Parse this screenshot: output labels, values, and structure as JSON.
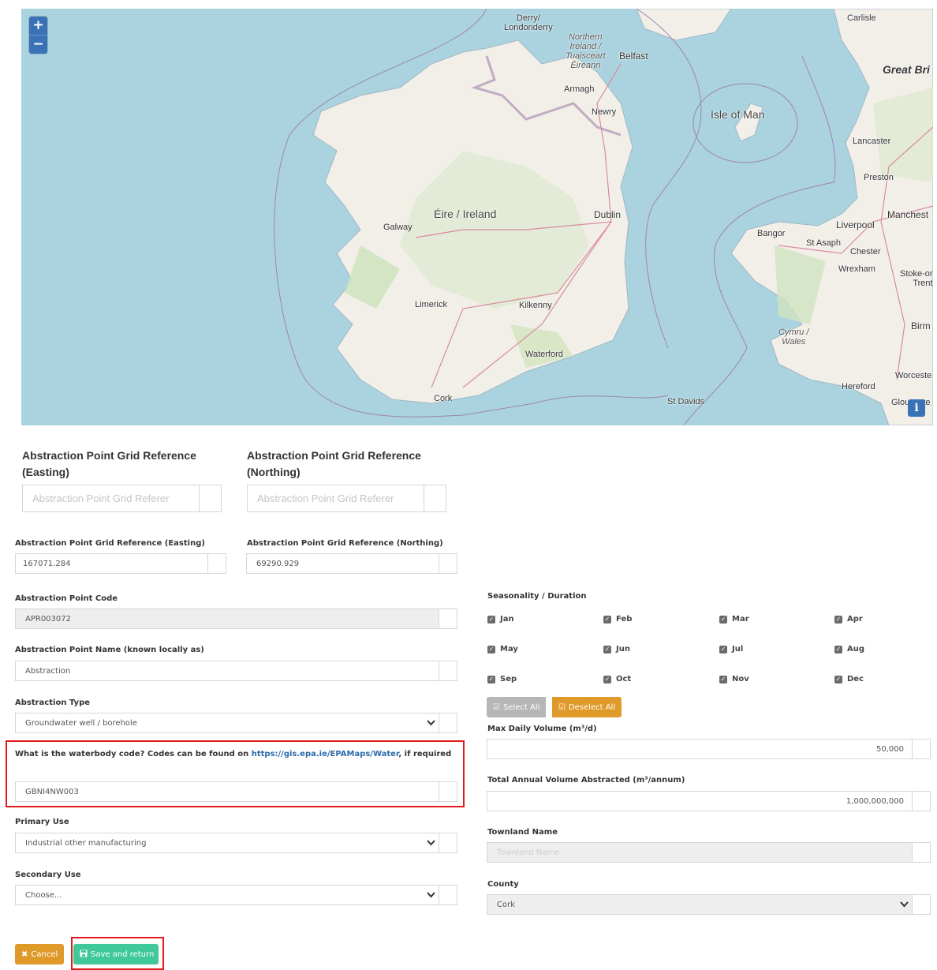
{
  "map": {
    "zoom_in": "+",
    "zoom_out": "−",
    "info": "i",
    "places": [
      {
        "id": "derry",
        "text": "Derry/\nLondonderry",
        "style": "pl",
        "css": "left:612px;top:6px;text-align:center;"
      },
      {
        "id": "ni",
        "text": "Northern\nIreland /\nTuaisceart\nÉireann",
        "style": "pl it",
        "css": "left:690px;top:30px;text-align:center;line-height:12px;"
      },
      {
        "id": "belfast",
        "text": "Belfast",
        "style": "pl",
        "css": "left:758px;top:53px;font-size:12px;"
      },
      {
        "id": "armagh",
        "text": "Armagh",
        "style": "pl",
        "css": "left:688px;top:96px;"
      },
      {
        "id": "newry",
        "text": "Newry",
        "style": "pl",
        "css": "left:723px;top:125px;"
      },
      {
        "id": "carlisle",
        "text": "Carlisle",
        "style": "pl",
        "css": "left:1047px;top:6px;"
      },
      {
        "id": "great",
        "text": "Great Bri",
        "style": "pl big it",
        "css": "left:1092px;top:69px;font-weight:bold;color:#333;"
      },
      {
        "id": "iom",
        "text": "Isle of Man",
        "style": "pl big",
        "css": "left:874px;top:126px;"
      },
      {
        "id": "lancaster",
        "text": "Lancaster",
        "style": "pl",
        "css": "left:1054px;top:162px;"
      },
      {
        "id": "preston",
        "text": "Preston",
        "style": "pl",
        "css": "left:1068px;top:208px;"
      },
      {
        "id": "ireland",
        "text": "Éire / Ireland",
        "style": "pl big",
        "css": "left:523px;top:252px;"
      },
      {
        "id": "dublin",
        "text": "Dublin",
        "style": "pl",
        "css": "left:726px;top:254px;font-size:12px;"
      },
      {
        "id": "galway",
        "text": "Galway",
        "style": "pl",
        "css": "left:459px;top:271px;"
      },
      {
        "id": "manchester",
        "text": "Manchest",
        "style": "pl",
        "css": "left:1098px;top:254px;font-size:12px;"
      },
      {
        "id": "liverpool",
        "text": "Liverpool",
        "style": "pl",
        "css": "left:1033px;top:267px;font-size:12px;"
      },
      {
        "id": "bangor",
        "text": "Bangor",
        "style": "pl",
        "css": "left:933px;top:279px;"
      },
      {
        "id": "stasaph",
        "text": "St Asaph",
        "style": "pl",
        "css": "left:995px;top:291px;"
      },
      {
        "id": "chester",
        "text": "Chester",
        "style": "pl",
        "css": "left:1051px;top:302px;"
      },
      {
        "id": "wrexham",
        "text": "Wrexham",
        "style": "pl",
        "css": "left:1036px;top:324px;"
      },
      {
        "id": "stoke",
        "text": "Stoke-or\nTrent",
        "style": "pl",
        "css": "left:1114px;top:330px;text-align:right;line-height:12px;"
      },
      {
        "id": "limerick",
        "text": "Limerick",
        "style": "pl",
        "css": "left:499px;top:369px;"
      },
      {
        "id": "kilkenny",
        "text": "Kilkenny",
        "style": "pl",
        "css": "left:631px;top:370px;"
      },
      {
        "id": "birm",
        "text": "Birm",
        "style": "pl",
        "css": "left:1128px;top:395px;font-size:12px;"
      },
      {
        "id": "wales",
        "text": "Cymru /\nWales",
        "style": "pl it",
        "css": "left:960px;top:404px;text-align:center;line-height:12px;"
      },
      {
        "id": "waterford",
        "text": "Waterford",
        "style": "pl",
        "css": "left:639px;top:432px;"
      },
      {
        "id": "worcester",
        "text": "Worceste",
        "style": "pl",
        "css": "left:1108px;top:459px;"
      },
      {
        "id": "hereford",
        "text": "Hereford",
        "style": "pl",
        "css": "left:1040px;top:473px;"
      },
      {
        "id": "cork",
        "text": "Cork",
        "style": "pl",
        "css": "left:523px;top:488px;"
      },
      {
        "id": "stdavids",
        "text": "St Davids",
        "style": "pl",
        "css": "left:819px;top:492px;"
      },
      {
        "id": "glouc",
        "text": "Glouceste",
        "style": "pl",
        "css": "left:1103px;top:493px;"
      }
    ]
  },
  "top_grid": {
    "easting_label": "Abstraction Point Grid Reference (Easting)",
    "northing_label": "Abstraction Point Grid Reference (Northing)",
    "easting_placeholder": "Abstraction Point Grid Referer",
    "northing_placeholder": "Abstraction Point Grid Referer"
  },
  "form": {
    "easting_label": "Abstraction Point Grid Reference (Easting)",
    "easting_value": "167071.284",
    "northing_label": "Abstraction Point Grid Reference (Northing)",
    "northing_value": "69290.929",
    "code_label": "Abstraction Point Code",
    "code_value": "APR003072",
    "name_label": "Abstraction Point Name (known locally as)",
    "name_value": "Abstraction",
    "type_label": "Abstraction Type",
    "type_value": "Groundwater well / borehole",
    "waterbody_label_pre": "What is the waterbody code? Codes can be found on ",
    "waterbody_link": "https://gis.epa.ie/EPAMaps/Water",
    "waterbody_label_post": ", if required",
    "waterbody_value": "GBNI4NW003",
    "primary_label": "Primary Use",
    "primary_value": "Industrial other manufacturing",
    "secondary_label": "Secondary Use",
    "secondary_value": "Choose..."
  },
  "season": {
    "label": "Seasonality / Duration",
    "months": [
      "Jan",
      "Feb",
      "Mar",
      "Apr",
      "May",
      "Jun",
      "Jul",
      "Aug",
      "Sep",
      "Oct",
      "Nov",
      "Dec"
    ],
    "select_all": "Select All",
    "deselect_all": "Deselect All"
  },
  "volumes": {
    "daily_label": "Max Daily Volume (m³/d)",
    "daily_value": "50,000",
    "annual_label": "Total Annual Volume Abstracted (m³/annum)",
    "annual_value": "1,000,000,000"
  },
  "location": {
    "townland_label": "Townland Name",
    "townland_placeholder": "Townland Name",
    "county_label": "County",
    "county_value": "Cork"
  },
  "actions": {
    "cancel": "Cancel",
    "save": "Save and return"
  },
  "colors": {
    "map_water": "#aad3df",
    "map_land": "#f2efe9",
    "accent_blue": "#3a72b6",
    "orange": "#e09a2a",
    "green": "#3fc89a",
    "highlight_red": "#e01b1b"
  }
}
